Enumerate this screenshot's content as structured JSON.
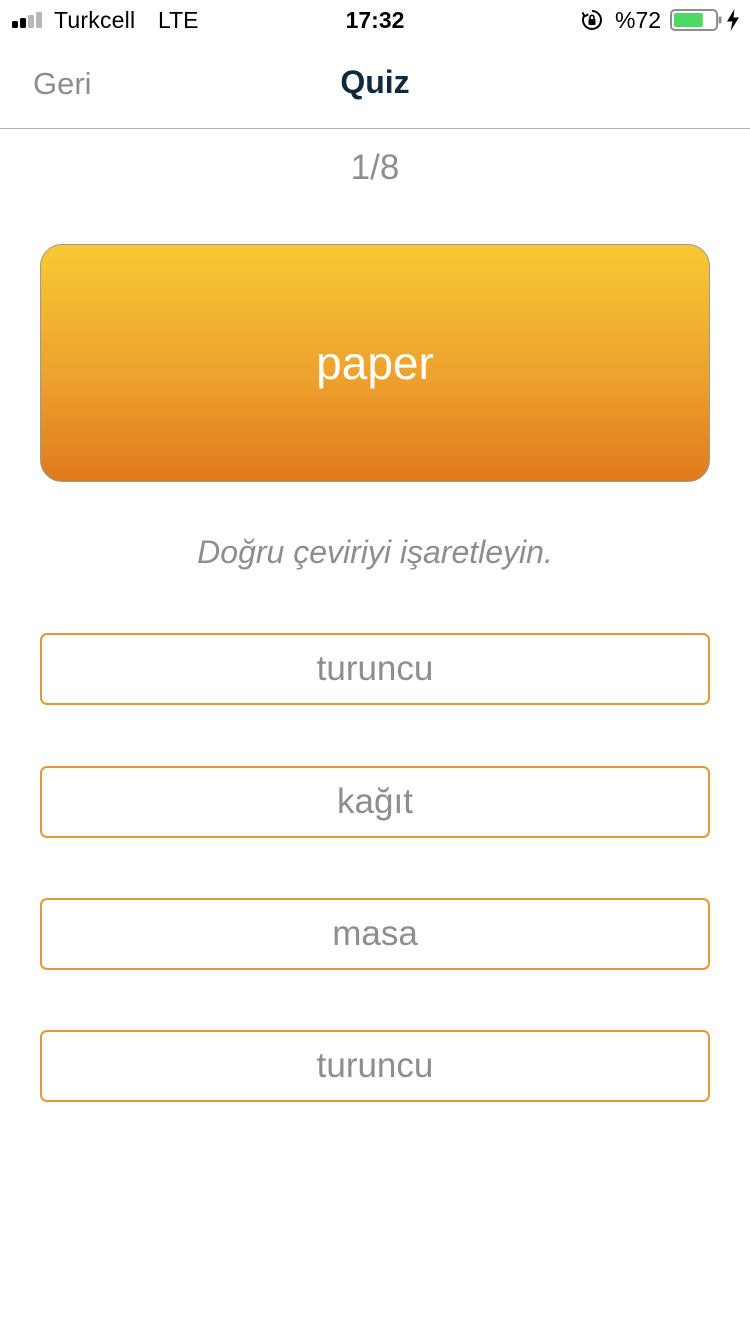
{
  "status_bar": {
    "carrier": "Turkcell",
    "network": "LTE",
    "time": "17:32",
    "battery_percent": "%72",
    "battery_level": 0.72,
    "signal_bars_filled": 2,
    "signal_bars_total": 4,
    "icons": [
      "signal-icon",
      "orientation-lock-icon",
      "battery-icon",
      "charging-bolt-icon"
    ],
    "battery_color": "#4cd964"
  },
  "nav": {
    "back_label": "Geri",
    "title": "Quiz"
  },
  "quiz": {
    "progress": "1/8",
    "word": "paper",
    "instruction": "Doğru çeviriyi işaretleyin.",
    "options": [
      {
        "label": "turuncu"
      },
      {
        "label": "kağıt"
      },
      {
        "label": "masa"
      },
      {
        "label": "turuncu"
      }
    ]
  },
  "colors": {
    "accent": "#e5973a",
    "card_top": "#f8c933",
    "card_bottom": "#e07b1c",
    "title": "#0e2a3c",
    "muted_text": "#8e8e8e"
  }
}
